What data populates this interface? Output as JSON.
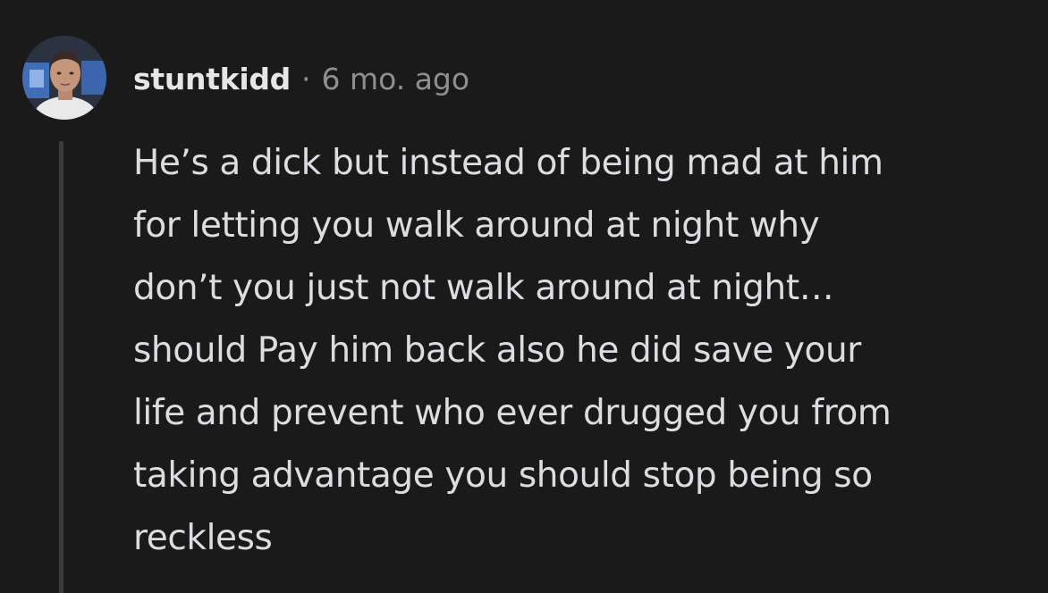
{
  "comment": {
    "author": "stuntkidd",
    "separator": "·",
    "timestamp": "6 mo. ago",
    "body_lines": [
      "He’s a dick but instead of being mad at him",
      "for letting you walk around at night why",
      "don’t you just not walk around at night…",
      "should Pay him back also he did save your",
      "life and prevent who ever drugged you from",
      "taking advantage you should stop being so",
      "reckless"
    ]
  },
  "colors": {
    "background": "#1a1a1b",
    "author_text": "#e4e6e8",
    "meta_text": "#8d9093",
    "body_text": "#dcdde0",
    "thread_line": "#3a3a3c"
  },
  "icons": {
    "avatar": "user-avatar"
  }
}
